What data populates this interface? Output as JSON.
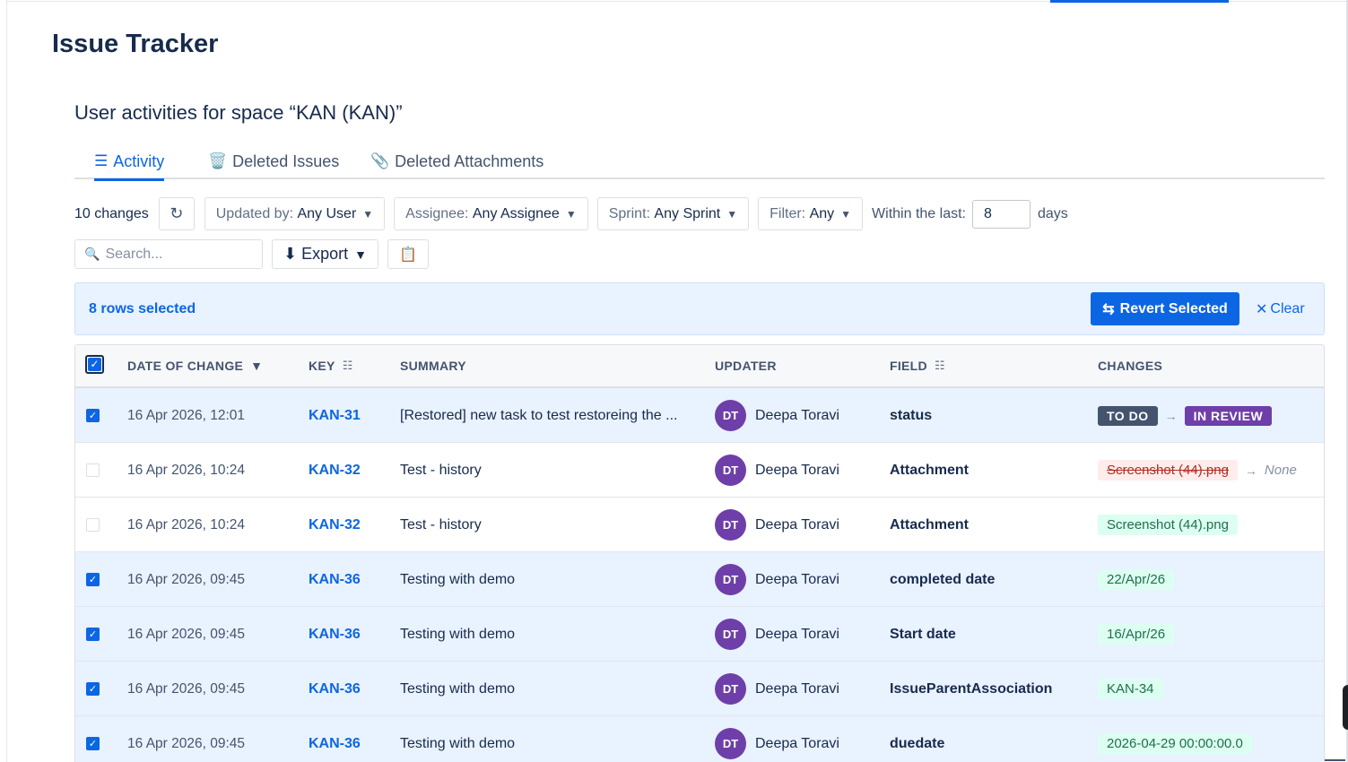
{
  "app_title": "Issue Tracker",
  "space_title": "User activities for space “KAN (KAN)”",
  "tabs": [
    {
      "icon": "☰",
      "label": "Activity"
    },
    {
      "icon": "🗑️",
      "label": "Deleted Issues"
    },
    {
      "icon": "📎",
      "label": "Deleted Attachments"
    }
  ],
  "filters": {
    "count": "10 changes",
    "refresh_icon": "↻",
    "updated_by_label": "Updated by:",
    "updated_by_value": "Any User",
    "assignee_label": "Assignee:",
    "assignee_value": "Any Assignee",
    "sprint_label": "Sprint:",
    "sprint_value": "Any Sprint",
    "filter_label": "Filter:",
    "filter_value": "Any",
    "caret": "▼",
    "within_label": "Within the last:",
    "within_value": "8",
    "days_label": "days"
  },
  "tools": {
    "search_icon": "🔍",
    "search_placeholder": "Search...",
    "export_label": "⬇ Export",
    "caret": "▼",
    "clipboard_icon": "📋"
  },
  "selection": {
    "text": "8 rows selected",
    "revert_icon": "⇆",
    "revert_label": "Revert Selected",
    "clear_icon": "✕",
    "clear_label": "Clear"
  },
  "table": {
    "headers": {
      "date": "DATE OF CHANGE",
      "date_sort": "▼",
      "key": "KEY",
      "summary": "SUMMARY",
      "updater": "UPDATER",
      "field": "FIELD",
      "changes": "CHANGES",
      "col_icon": "☷"
    },
    "check_mark": "✓",
    "rows": [
      {
        "selected": true,
        "date": "16 Apr 2026, 12:01",
        "key": "KAN-31",
        "summary": "[Restored] new task to test restoreing the ...",
        "initials": "DT",
        "updater": "Deepa Toravi",
        "field": "status",
        "change_type": "status",
        "from": "TO DO",
        "to": "IN REVIEW"
      },
      {
        "selected": false,
        "date": "16 Apr 2026, 10:24",
        "key": "KAN-32",
        "summary": "Test - history",
        "initials": "DT",
        "updater": "Deepa Toravi",
        "field": "Attachment",
        "change_type": "removed",
        "from": "Screenshot (44).png",
        "to": "None"
      },
      {
        "selected": false,
        "date": "16 Apr 2026, 10:24",
        "key": "KAN-32",
        "summary": "Test - history",
        "initials": "DT",
        "updater": "Deepa Toravi",
        "field": "Attachment",
        "change_type": "added",
        "to": "Screenshot (44).png"
      },
      {
        "selected": true,
        "date": "16 Apr 2026, 09:45",
        "key": "KAN-36",
        "summary": "Testing with demo",
        "initials": "DT",
        "updater": "Deepa Toravi",
        "field": "completed date",
        "change_type": "added",
        "to": "22/Apr/26"
      },
      {
        "selected": true,
        "date": "16 Apr 2026, 09:45",
        "key": "KAN-36",
        "summary": "Testing with demo",
        "initials": "DT",
        "updater": "Deepa Toravi",
        "field": "Start date",
        "change_type": "added",
        "to": "16/Apr/26"
      },
      {
        "selected": true,
        "date": "16 Apr 2026, 09:45",
        "key": "KAN-36",
        "summary": "Testing with demo",
        "initials": "DT",
        "updater": "Deepa Toravi",
        "field": "IssueParentAssociation",
        "change_type": "added",
        "to": "KAN-34"
      },
      {
        "selected": true,
        "date": "16 Apr 2026, 09:45",
        "key": "KAN-36",
        "summary": "Testing with demo",
        "initials": "DT",
        "updater": "Deepa Toravi",
        "field": "duedate",
        "change_type": "added",
        "to": "2026-04-29 00:00:00.0"
      }
    ]
  },
  "colors": {
    "accent": "#0c66e4",
    "status_todo": "#44546f",
    "status_review": "#6e3fa8",
    "avatar": "#6e3fa8",
    "removed_bg": "#ffeceb",
    "added_bg": "#dcfff1"
  }
}
